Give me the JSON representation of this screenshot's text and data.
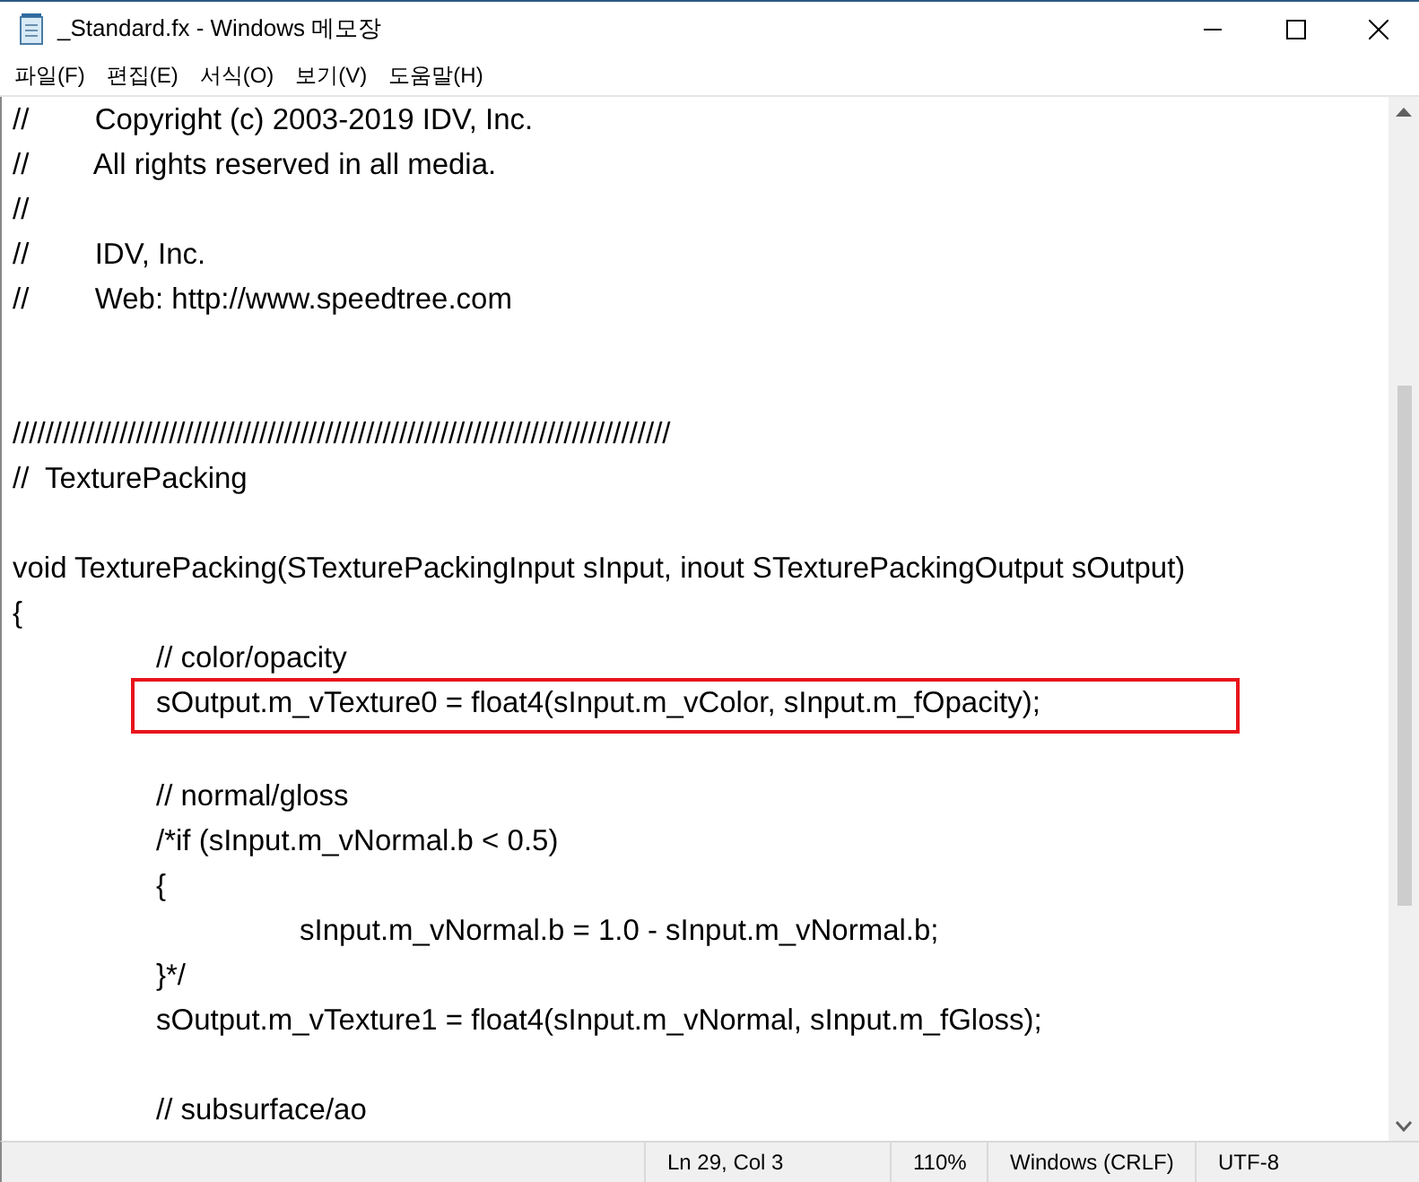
{
  "window": {
    "title": "_Standard.fx - Windows 메모장"
  },
  "menu": [
    "파일(F)",
    "편집(E)",
    "서식(O)",
    "보기(V)",
    "도움말(H)"
  ],
  "editor": {
    "lines": [
      {
        "kind": "code",
        "text": "//        Copyright (c) 2003-2019 IDV, Inc.",
        "highlighted": false
      },
      {
        "kind": "code",
        "text": "//        All rights reserved in all media.",
        "highlighted": false
      },
      {
        "kind": "code",
        "text": "//",
        "highlighted": false
      },
      {
        "kind": "code",
        "text": "//        IDV, Inc.",
        "highlighted": false
      },
      {
        "kind": "code",
        "text": "//        Web: http://www.speedtree.com",
        "highlighted": false
      },
      {
        "kind": "blank"
      },
      {
        "kind": "blank"
      },
      {
        "kind": "code",
        "text": "////////////////////////////////////////////////////////////////////////////////",
        "highlighted": false
      },
      {
        "kind": "code",
        "text": "//  TexturePacking",
        "highlighted": false
      },
      {
        "kind": "blank"
      },
      {
        "kind": "code",
        "text": "void TexturePacking(STexturePackingInput sInput, inout STexturePackingOutput sOutput)",
        "highlighted": false
      },
      {
        "kind": "code",
        "text": "{",
        "highlighted": false
      },
      {
        "kind": "code",
        "text": "\t// color/opacity",
        "highlighted": false
      },
      {
        "kind": "code",
        "text": "\tsOutput.m_vTexture0 = float4(sInput.m_vColor, sInput.m_fOpacity);",
        "highlighted": true
      },
      {
        "kind": "blank"
      },
      {
        "kind": "code",
        "text": "\t// normal/gloss",
        "highlighted": false
      },
      {
        "kind": "code",
        "text": "\t/*if (sInput.m_vNormal.b < 0.5)",
        "highlighted": false
      },
      {
        "kind": "code",
        "text": "\t{",
        "highlighted": false
      },
      {
        "kind": "code",
        "text": "\t\tsInput.m_vNormal.b = 1.0 - sInput.m_vNormal.b;",
        "highlighted": false
      },
      {
        "kind": "code",
        "text": "\t}*/",
        "highlighted": false
      },
      {
        "kind": "code",
        "text": "\tsOutput.m_vTexture1 = float4(sInput.m_vNormal, sInput.m_fGloss);",
        "highlighted": false
      },
      {
        "kind": "blank"
      },
      {
        "kind": "code",
        "text": "\t// subsurface/ao",
        "highlighted": false
      }
    ]
  },
  "status_bar": {
    "position": "Ln 29, Col 3",
    "zoom": "110%",
    "line_ending": "Windows (CRLF)",
    "encoding": "UTF-8"
  }
}
